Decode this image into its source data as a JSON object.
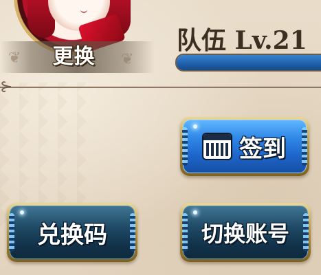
{
  "profile": {
    "change_label": "更换"
  },
  "team": {
    "level_text": "队伍 Lv.21",
    "xp_progress": 1.0,
    "xp_color": "#1e5faa"
  },
  "buttons": {
    "checkin_label": "签到",
    "checkin_icon": "calendar-icon",
    "redeem_label": "兑换码",
    "switch_account_label": "切换账号"
  },
  "colors": {
    "blue_button": "#2f86e6",
    "dark_button": "#1f4a66",
    "gold_border": "#b3933f",
    "background": "#e8dccb"
  }
}
